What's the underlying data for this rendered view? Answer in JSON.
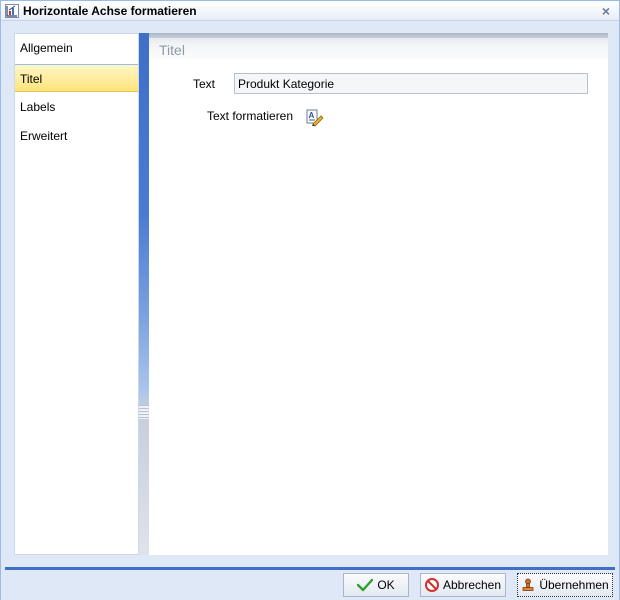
{
  "window": {
    "title": "Horizontale Achse formatieren",
    "close_glyph": "×"
  },
  "nav": {
    "items": [
      {
        "label": "Allgemein",
        "active": false
      },
      {
        "label": "Titel",
        "active": true
      },
      {
        "label": "Labels",
        "active": false
      },
      {
        "label": "Erweitert",
        "active": false
      }
    ]
  },
  "content": {
    "section_title": "Titel",
    "text_label": "Text",
    "text_value": "Produkt Kategorie",
    "format_label": "Text formatieren"
  },
  "footer": {
    "ok_label": "OK",
    "cancel_label": "Abbrechen",
    "apply_label": "Übernehmen"
  },
  "icons": {
    "title": "chart-axis-icon",
    "format": "text-format-icon",
    "ok": "check-icon",
    "cancel": "no-entry-icon",
    "apply": "stamp-icon"
  },
  "colors": {
    "accent": "#3f6fc9",
    "active_item": "#ffe37a",
    "window_bg": "#dfe8f6"
  }
}
